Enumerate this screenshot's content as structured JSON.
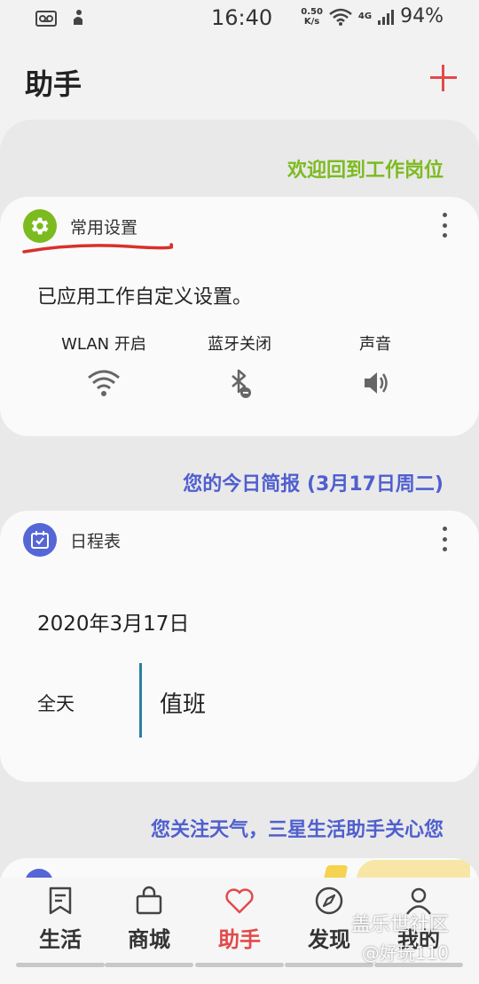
{
  "status_bar": {
    "time": "16:40",
    "net_speed_value": "0.50",
    "net_speed_unit": "K/s",
    "network_type": "4G",
    "battery": "94%"
  },
  "header": {
    "title": "助手"
  },
  "sections": {
    "welcome_heading": "欢迎回到工作岗位",
    "briefing_heading": "您的今日简报 (3月17日周二)",
    "weather_heading": "您关注天气，三星生活助手关心您"
  },
  "settings_card": {
    "title": "常用设置",
    "message": "已应用工作自定义设置。",
    "quick_settings": [
      {
        "label": "WLAN 开启",
        "icon": "wifi-icon"
      },
      {
        "label": "蓝牙关闭",
        "icon": "bluetooth-off-icon"
      },
      {
        "label": "声音",
        "icon": "volume-icon"
      }
    ],
    "accent_color": "#7cbb1f"
  },
  "schedule_card": {
    "title": "日程表",
    "date": "2020年3月17日",
    "events": [
      {
        "time": "全天",
        "title": "值班"
      }
    ],
    "accent_color": "#5566d6"
  },
  "bottom_nav": {
    "items": [
      {
        "label": "生活",
        "icon": "bookmark-icon",
        "active": false
      },
      {
        "label": "商城",
        "icon": "shopping-bag-icon",
        "active": false
      },
      {
        "label": "助手",
        "icon": "heart-icon",
        "active": true
      },
      {
        "label": "发现",
        "icon": "compass-icon",
        "active": false
      },
      {
        "label": "我的",
        "icon": "person-icon",
        "active": false
      }
    ],
    "active_color": "#e24a4a"
  },
  "watermark": {
    "line1": "盖乐世社区",
    "line2": "@好玩110"
  }
}
